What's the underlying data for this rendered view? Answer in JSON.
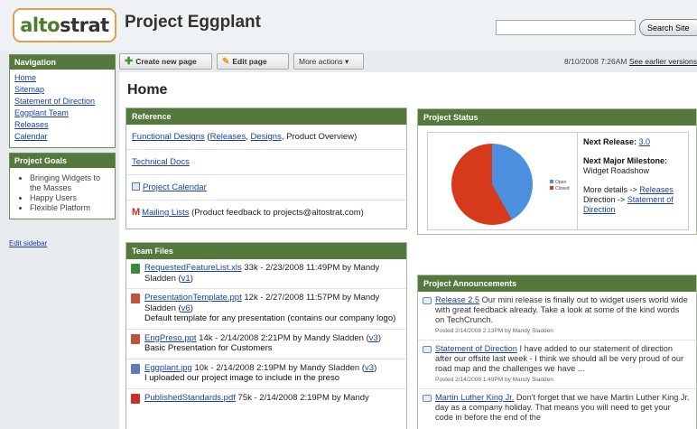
{
  "header": {
    "logo_alto": "alto",
    "logo_strat": "strat",
    "title": "Project Eggplant",
    "search_placeholder": "",
    "search_button": "Search Site"
  },
  "sidebar": {
    "nav_title": "Navigation",
    "nav_items": [
      "Home",
      "Sitemap",
      "Statement of Direction",
      "Eggplant Team",
      "Releases",
      "Calendar"
    ],
    "goals_title": "Project Goals",
    "goals": [
      "Bringing Widgets to the Masses",
      "Happy Users",
      "Flexible Platform"
    ],
    "edit_sidebar": "Edit sidebar"
  },
  "toolbar": {
    "create_label": "Create new page",
    "edit_label": "Edit page",
    "more_label": "More actions",
    "date": "8/10/2008 7:26AM",
    "earlier_versions": "See earlier versions"
  },
  "main": {
    "home_title": "Home"
  },
  "reference": {
    "title": "Reference",
    "functional_designs": "Functional Designs",
    "paren_open": " (",
    "releases": "Releases",
    "comma1": ", ",
    "designs": "Designs",
    "rest": ", Product Overview)",
    "technical_docs": "Technical Docs",
    "project_calendar": "Project Calendar",
    "mailing_lists": "Mailing Lists",
    "mailing_note": " (Product feedback to projects@altostrat.com)"
  },
  "team_files": {
    "title": "Team Files",
    "files": [
      {
        "icon": "xls",
        "name": "RequestedFeatureList.xls",
        "meta": " 33k - 2/23/2008 11:49PM by Mandy Sladden (",
        "ver": "v1",
        "close": ")",
        "desc": ""
      },
      {
        "icon": "ppt",
        "name": "PresentationTemplate.ppt",
        "meta": " 12k - 2/27/2008 11:57PM by Mandy Sladden (",
        "ver": "v6",
        "close": ")",
        "desc": "Default template for any presentation (contains our company logo)"
      },
      {
        "icon": "ppt",
        "name": "EngPreso.ppt",
        "meta": " 14k - 2/14/2008 2:21PM by Mandy Sladden (",
        "ver": "v3",
        "close": ")",
        "desc": "Basic Presentation for Customers"
      },
      {
        "icon": "jpg",
        "name": "Eggplant.jpg",
        "meta": " 10k - 2/14/2008 2:19PM by Mandy Sladden (",
        "ver": "v3",
        "close": ")",
        "desc": "I uploaded our project image to include in the preso"
      },
      {
        "icon": "pdf",
        "name": "PublishedStandards.pdf",
        "meta": " 75k - 2/14/2008 2:19PM by Mandy",
        "ver": "",
        "close": "",
        "desc": ""
      }
    ]
  },
  "project_status": {
    "title": "Project Status",
    "legend_open": "Open",
    "legend_closed": "Closed",
    "color_open": "#4b8fde",
    "color_closed": "#d63a1a",
    "open_fraction": 0.42,
    "next_release_label": "Next Release: ",
    "next_release_value": "3.0",
    "milestone_label": "Next Major Milestone:",
    "milestone_value": "Widget Roadshow",
    "more_details": "More details -> ",
    "releases_link": "Releases",
    "direction": "Direction -> ",
    "sod_link": "Statement of Direction"
  },
  "announcements": {
    "title": "Project Announcements",
    "items": [
      {
        "link": "Release 2.5",
        "body": " Our mini release is finally out to widget users world wide with great feedback already. Take a look at some of the kind words on TechCrunch.",
        "meta": "Posted 2/14/2008 2:13PM by Mandy Sladden"
      },
      {
        "link": "Statement of Direction",
        "body": " I have added to our statement of direction after our offsite last week - I think we should all be very proud of our road map and the challenges we have ...",
        "meta": "Posted 2/14/2008 1:49PM by Mandy Sladden"
      },
      {
        "link": "Martin Luther King Jr.",
        "body": " Don't forget that we have Martin Luther King Jr. day as a company holiday. That means you will need to get your code in before the end of the",
        "meta": ""
      }
    ]
  },
  "colors": {
    "header_green": "#55793d",
    "link_blue": "#1a3fa8",
    "logo_orange": "#e0a050"
  }
}
